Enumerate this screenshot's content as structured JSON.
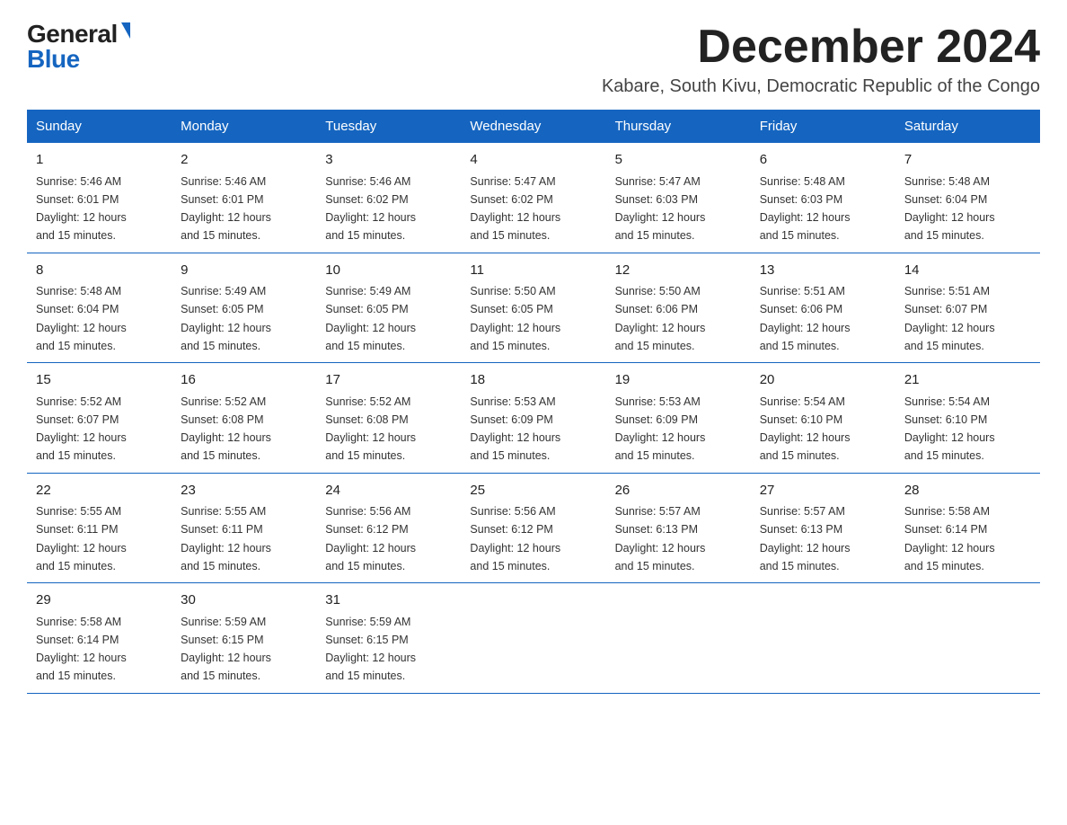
{
  "logo": {
    "general": "General",
    "blue": "Blue"
  },
  "title": "December 2024",
  "subtitle": "Kabare, South Kivu, Democratic Republic of the Congo",
  "days_of_week": [
    "Sunday",
    "Monday",
    "Tuesday",
    "Wednesday",
    "Thursday",
    "Friday",
    "Saturday"
  ],
  "weeks": [
    [
      {
        "day": "1",
        "sunrise": "5:46 AM",
        "sunset": "6:01 PM",
        "daylight": "12 hours and 15 minutes."
      },
      {
        "day": "2",
        "sunrise": "5:46 AM",
        "sunset": "6:01 PM",
        "daylight": "12 hours and 15 minutes."
      },
      {
        "day": "3",
        "sunrise": "5:46 AM",
        "sunset": "6:02 PM",
        "daylight": "12 hours and 15 minutes."
      },
      {
        "day": "4",
        "sunrise": "5:47 AM",
        "sunset": "6:02 PM",
        "daylight": "12 hours and 15 minutes."
      },
      {
        "day": "5",
        "sunrise": "5:47 AM",
        "sunset": "6:03 PM",
        "daylight": "12 hours and 15 minutes."
      },
      {
        "day": "6",
        "sunrise": "5:48 AM",
        "sunset": "6:03 PM",
        "daylight": "12 hours and 15 minutes."
      },
      {
        "day": "7",
        "sunrise": "5:48 AM",
        "sunset": "6:04 PM",
        "daylight": "12 hours and 15 minutes."
      }
    ],
    [
      {
        "day": "8",
        "sunrise": "5:48 AM",
        "sunset": "6:04 PM",
        "daylight": "12 hours and 15 minutes."
      },
      {
        "day": "9",
        "sunrise": "5:49 AM",
        "sunset": "6:05 PM",
        "daylight": "12 hours and 15 minutes."
      },
      {
        "day": "10",
        "sunrise": "5:49 AM",
        "sunset": "6:05 PM",
        "daylight": "12 hours and 15 minutes."
      },
      {
        "day": "11",
        "sunrise": "5:50 AM",
        "sunset": "6:05 PM",
        "daylight": "12 hours and 15 minutes."
      },
      {
        "day": "12",
        "sunrise": "5:50 AM",
        "sunset": "6:06 PM",
        "daylight": "12 hours and 15 minutes."
      },
      {
        "day": "13",
        "sunrise": "5:51 AM",
        "sunset": "6:06 PM",
        "daylight": "12 hours and 15 minutes."
      },
      {
        "day": "14",
        "sunrise": "5:51 AM",
        "sunset": "6:07 PM",
        "daylight": "12 hours and 15 minutes."
      }
    ],
    [
      {
        "day": "15",
        "sunrise": "5:52 AM",
        "sunset": "6:07 PM",
        "daylight": "12 hours and 15 minutes."
      },
      {
        "day": "16",
        "sunrise": "5:52 AM",
        "sunset": "6:08 PM",
        "daylight": "12 hours and 15 minutes."
      },
      {
        "day": "17",
        "sunrise": "5:52 AM",
        "sunset": "6:08 PM",
        "daylight": "12 hours and 15 minutes."
      },
      {
        "day": "18",
        "sunrise": "5:53 AM",
        "sunset": "6:09 PM",
        "daylight": "12 hours and 15 minutes."
      },
      {
        "day": "19",
        "sunrise": "5:53 AM",
        "sunset": "6:09 PM",
        "daylight": "12 hours and 15 minutes."
      },
      {
        "day": "20",
        "sunrise": "5:54 AM",
        "sunset": "6:10 PM",
        "daylight": "12 hours and 15 minutes."
      },
      {
        "day": "21",
        "sunrise": "5:54 AM",
        "sunset": "6:10 PM",
        "daylight": "12 hours and 15 minutes."
      }
    ],
    [
      {
        "day": "22",
        "sunrise": "5:55 AM",
        "sunset": "6:11 PM",
        "daylight": "12 hours and 15 minutes."
      },
      {
        "day": "23",
        "sunrise": "5:55 AM",
        "sunset": "6:11 PM",
        "daylight": "12 hours and 15 minutes."
      },
      {
        "day": "24",
        "sunrise": "5:56 AM",
        "sunset": "6:12 PM",
        "daylight": "12 hours and 15 minutes."
      },
      {
        "day": "25",
        "sunrise": "5:56 AM",
        "sunset": "6:12 PM",
        "daylight": "12 hours and 15 minutes."
      },
      {
        "day": "26",
        "sunrise": "5:57 AM",
        "sunset": "6:13 PM",
        "daylight": "12 hours and 15 minutes."
      },
      {
        "day": "27",
        "sunrise": "5:57 AM",
        "sunset": "6:13 PM",
        "daylight": "12 hours and 15 minutes."
      },
      {
        "day": "28",
        "sunrise": "5:58 AM",
        "sunset": "6:14 PM",
        "daylight": "12 hours and 15 minutes."
      }
    ],
    [
      {
        "day": "29",
        "sunrise": "5:58 AM",
        "sunset": "6:14 PM",
        "daylight": "12 hours and 15 minutes."
      },
      {
        "day": "30",
        "sunrise": "5:59 AM",
        "sunset": "6:15 PM",
        "daylight": "12 hours and 15 minutes."
      },
      {
        "day": "31",
        "sunrise": "5:59 AM",
        "sunset": "6:15 PM",
        "daylight": "12 hours and 15 minutes."
      },
      null,
      null,
      null,
      null
    ]
  ]
}
